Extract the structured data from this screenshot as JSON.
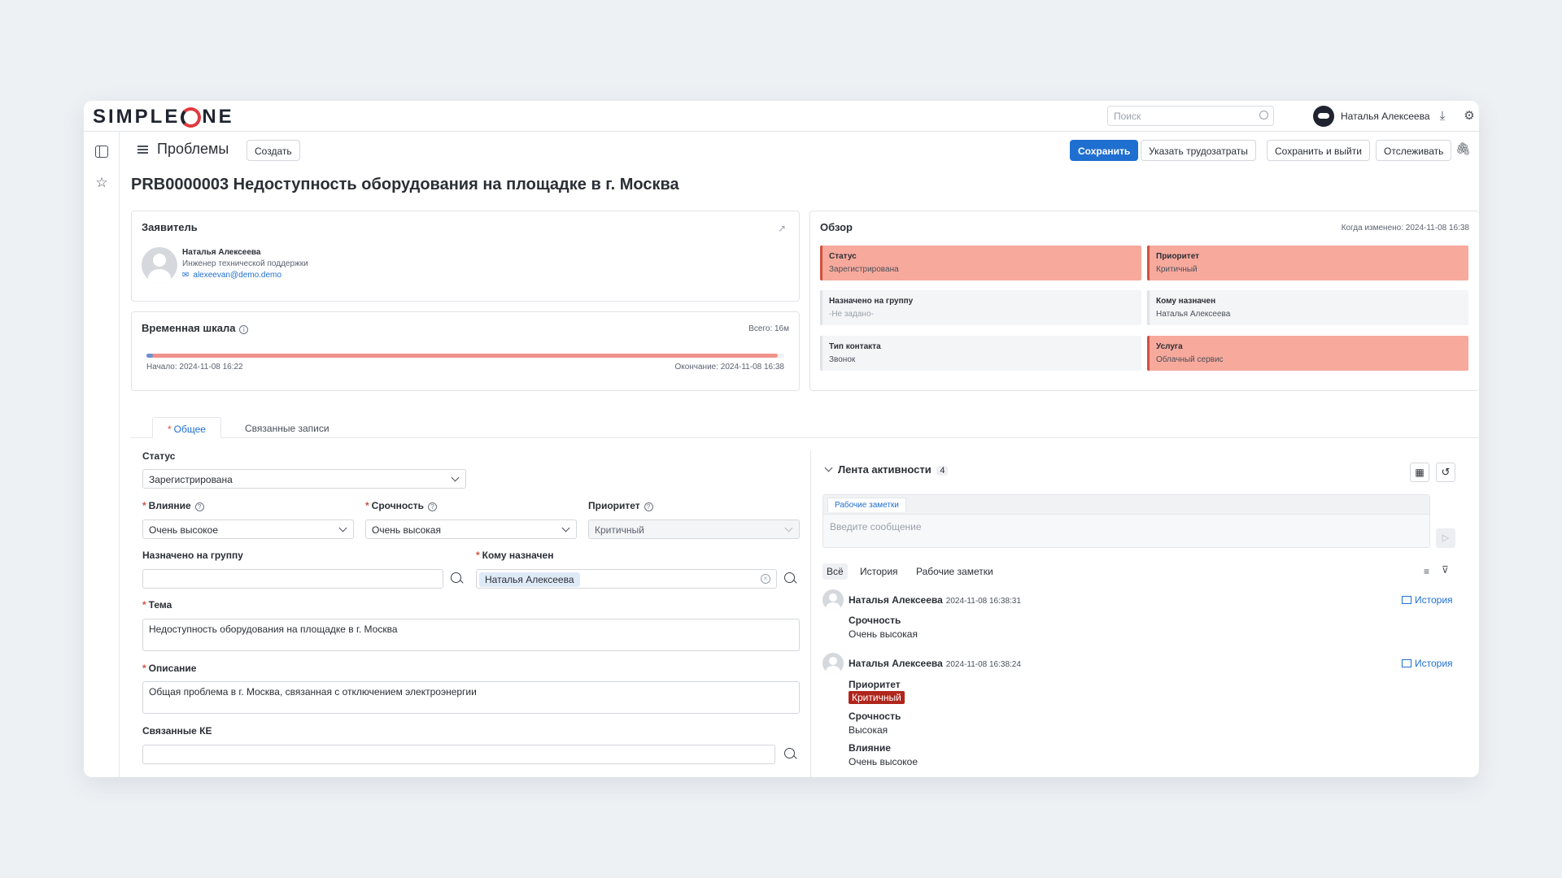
{
  "topbar": {
    "logo_prefix": "SIMPLE",
    "logo_suffix": "NE",
    "search_placeholder": "Поиск",
    "user_name": "Наталья Алексеева"
  },
  "toolbar": {
    "breadcrumb": "Проблемы",
    "create_label": "Создать",
    "save_label": "Сохранить",
    "time_label": "Указать трудозатраты",
    "save_exit_label": "Сохранить и выйти",
    "track_label": "Отслеживать"
  },
  "page_title": "PRB0000003 Недоступность оборудования на площадке в г. Москва",
  "requester": {
    "header": "Заявитель",
    "name": "Наталья Алексеева",
    "position": "Инженер технической поддержки",
    "email": "alexeevan@demo.demo"
  },
  "timeline": {
    "header": "Временная шкала",
    "total": "Всего: 16м",
    "start": "Начало: 2024-11-08 16:22",
    "end": "Окончание: 2024-11-08 16:38",
    "progress": 0.99
  },
  "overview": {
    "header": "Обзор",
    "changed": "Когда изменено: 2024-11-08 16:38",
    "tiles": [
      {
        "label": "Статус",
        "value": "Зарегистрирована"
      },
      {
        "label": "Приоритет",
        "value": "Критичный"
      },
      {
        "label": "Назначено на группу",
        "value": "-Не задано-"
      },
      {
        "label": "Кому назначен",
        "value": "Наталья Алексеева"
      },
      {
        "label": "Тип контакта",
        "value": "Звонок"
      },
      {
        "label": "Услуга",
        "value": "Облачный сервис"
      }
    ]
  },
  "tabs": {
    "general": "Общее",
    "related": "Связанные записи"
  },
  "form": {
    "status_label": "Статус",
    "status_value": "Зарегистрирована",
    "impact_label": "Влияние",
    "impact_value": "Очень высокое",
    "urgency_label": "Срочность",
    "urgency_value": "Очень высокая",
    "priority_label": "Приоритет",
    "priority_value": "Критичный",
    "group_label": "Назначено на группу",
    "group_value": "",
    "assignee_label": "Кому назначен",
    "assignee_value": "Наталья Алексеева",
    "subject_label": "Тема",
    "subject_value": "Недоступность оборудования на площадке в г. Москва",
    "description_label": "Описание",
    "description_value": "Общая проблема в г. Москва, связанная с отключением электроэнергии",
    "ci_label": "Связанные КЕ",
    "ci_value": ""
  },
  "activity": {
    "header": "Лента активности",
    "count": "4",
    "notes_tab": "Рабочие заметки",
    "message_placeholder": "Введите сообщение",
    "filter_all": "Всё",
    "filter_history": "История",
    "filter_notes": "Рабочие заметки",
    "history_link": "История",
    "entries": [
      {
        "name": "Наталья Алексеева",
        "time": "2024-11-08 16:38:31",
        "changes": [
          {
            "field": "Срочность",
            "value": "Очень высокая"
          }
        ]
      },
      {
        "name": "Наталья Алексеева",
        "time": "2024-11-08 16:38:24",
        "changes": [
          {
            "field": "Приоритет",
            "value": "Критичный"
          },
          {
            "field": "Срочность",
            "value": "Высокая"
          },
          {
            "field": "Влияние",
            "value": "Очень высокое"
          }
        ]
      }
    ]
  },
  "colors": {
    "primary": "#1f6fd0",
    "tile_red": "#f7a99c",
    "critical_badge": "#b0251b"
  }
}
